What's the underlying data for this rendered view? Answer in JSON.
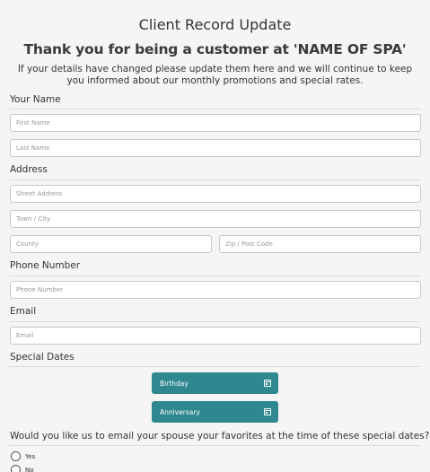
{
  "form": {
    "title": "Client Record Update",
    "subtitle": "Thank you for being a customer at 'NAME OF SPA'",
    "intro": "If your details have changed please update them here and we will continue to keep you informed about our monthly promotions and special rates."
  },
  "sections": {
    "name": "Your Name",
    "address": "Address",
    "phone": "Phone Number",
    "email": "Email",
    "special_dates": "Special Dates"
  },
  "fields": {
    "first_name": {
      "placeholder": "First Name",
      "value": ""
    },
    "last_name": {
      "placeholder": "Last Name",
      "value": ""
    },
    "street": {
      "placeholder": "Street Address",
      "value": ""
    },
    "town": {
      "placeholder": "Town / City",
      "value": ""
    },
    "county": {
      "placeholder": "County",
      "value": ""
    },
    "zip": {
      "placeholder": "Zip / Post Code",
      "value": ""
    },
    "phone": {
      "placeholder": "Phone Number",
      "value": ""
    },
    "email": {
      "placeholder": "Email",
      "value": ""
    }
  },
  "dates": {
    "birthday_label": "Birthday",
    "anniversary_label": "Anniversary",
    "icon": "calendar-icon"
  },
  "spouse_question": {
    "label": "Would you like us to email your spouse your favorites at the time of these special dates?",
    "options": [
      "Yes",
      "No"
    ]
  },
  "colors": {
    "accent": "#2f8790",
    "background": "#f5f5f3"
  }
}
